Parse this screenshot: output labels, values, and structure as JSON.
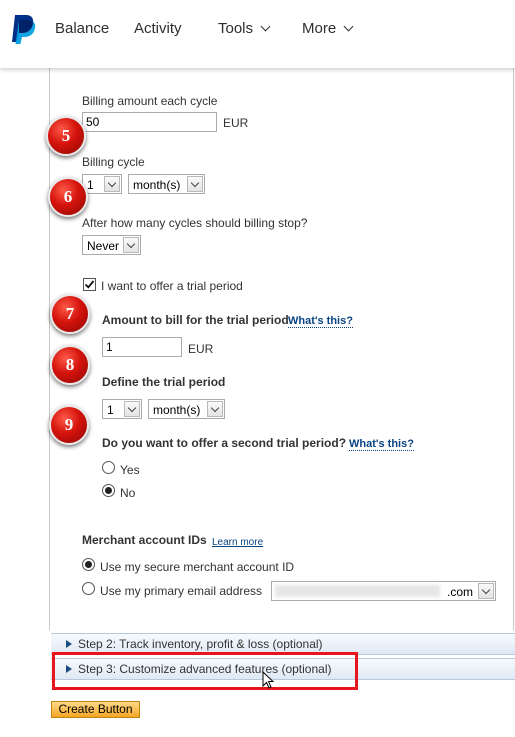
{
  "nav": {
    "items": [
      {
        "label": "Balance"
      },
      {
        "label": "Activity"
      },
      {
        "label": "Tools"
      },
      {
        "label": "More"
      }
    ]
  },
  "billing": {
    "amount_label": "Billing amount each cycle",
    "amount_value": "50",
    "amount_currency": "EUR",
    "cycle_label": "Billing cycle",
    "cycle_count": "1",
    "cycle_unit": "month(s)",
    "stop_label": "After how many cycles should billing stop?",
    "stop_value": "Never"
  },
  "trial": {
    "offer_label": "I want to offer a trial period",
    "offer_checked": true,
    "amount_label": "Amount to bill for the trial period",
    "whats_this": "What's this?",
    "amount_value": "1",
    "amount_currency": "EUR",
    "define_label": "Define the trial period",
    "define_count": "1",
    "define_unit": "month(s)",
    "second_label": "Do you want to offer a second trial period?",
    "second_whats_this": "What's this?",
    "yes_label": "Yes",
    "no_label": "No",
    "selected": "No"
  },
  "merchant": {
    "title": "Merchant account IDs",
    "learn_more": "Learn more",
    "secure_label": "Use my secure merchant account ID",
    "primary_label": "Use my primary email address",
    "email_domain": ".com",
    "selected": "secure"
  },
  "steps": [
    {
      "label": "Step 2: Track inventory, profit & loss (optional)"
    },
    {
      "label": "Step 3: Customize advanced features (optional)"
    }
  ],
  "badges": [
    "5",
    "6",
    "7",
    "8",
    "9"
  ],
  "create_button": "Create Button",
  "colors": {
    "brand_dark": "#003087",
    "brand_light": "#009cde",
    "badge_red": "#d4130c",
    "highlight_red": "#e5161d",
    "link": "#084482",
    "button_orange": "#f5a623"
  }
}
